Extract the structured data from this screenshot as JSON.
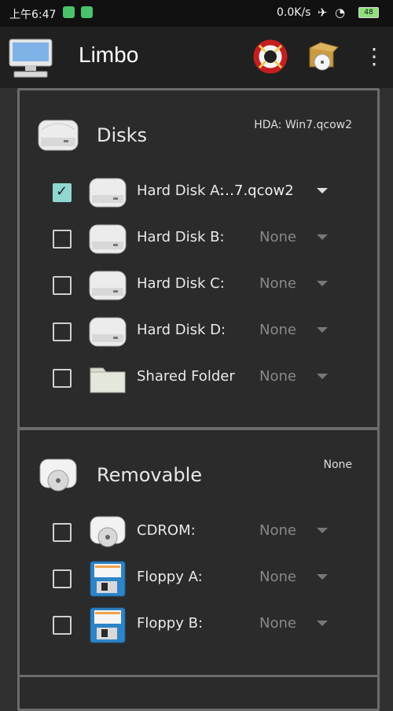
{
  "status": {
    "time": "上午6:47",
    "net": "0.0K/s",
    "battery": "48"
  },
  "app": {
    "title": "Limbo"
  },
  "disks": {
    "title": "Disks",
    "summary": "HDA: Win7.qcow2",
    "items": [
      {
        "label": "Hard Disk A:",
        "value": "…7.qcow2",
        "checked": true
      },
      {
        "label": "Hard Disk B:",
        "value": "None",
        "checked": false
      },
      {
        "label": "Hard Disk C:",
        "value": "None",
        "checked": false
      },
      {
        "label": "Hard Disk D:",
        "value": "None",
        "checked": false
      },
      {
        "label": "Shared Folder",
        "value": "None",
        "checked": false
      }
    ]
  },
  "removable": {
    "title": "Removable",
    "summary": "None",
    "items": [
      {
        "label": "CDROM:",
        "value": "None",
        "checked": false
      },
      {
        "label": "Floppy A:",
        "value": "None",
        "checked": false
      },
      {
        "label": "Floppy B:",
        "value": "None",
        "checked": false
      }
    ]
  },
  "icons": [
    "computer-icon",
    "help-icon",
    "drive-icon",
    "menu-icon",
    "hard-disk-icon",
    "folder-icon",
    "cdrom-icon",
    "floppy-icon",
    "dropdown-icon",
    "check-icon"
  ]
}
